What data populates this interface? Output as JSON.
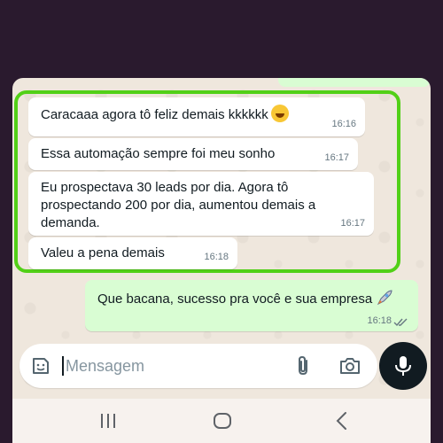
{
  "messages": [
    {
      "text": "Caracaaa agora tô feliz demais kkkkkk",
      "emoji": "tears-of-joy-emoji",
      "time": "16:16"
    },
    {
      "text": "Essa automação sempre foi meu sonho",
      "time": "16:17"
    },
    {
      "text": "Eu prospectava 30 leads por dia. Agora tô prospectando 200 por dia, aumentou demais a demanda.",
      "time": "16:17"
    },
    {
      "text": "Valeu a pena demais",
      "time": "16:18"
    }
  ],
  "sent_message": {
    "text": "Que bacana, sucesso pra você e sua empresa",
    "emoji": "rocket-emoji",
    "time": "16:18",
    "status": "read-double-check"
  },
  "composer": {
    "placeholder": "Mensagem"
  },
  "colors": {
    "highlight": "#52d017",
    "outgoing_bubble": "#d9fdd3",
    "incoming_bubble": "#ffffff",
    "chat_bg": "#efe7dd"
  }
}
